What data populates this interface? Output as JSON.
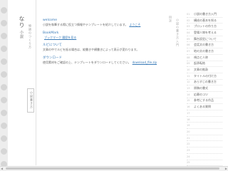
{
  "nav": {
    "logo_line1": "なり",
    "logo_line2": "小説",
    "logo_sub": "物語のつくり方",
    "box_label": "小説書き方"
  },
  "sections": [
    {
      "head": "welcome",
      "body": "小説を執筆する際に役立つ情報やテンプレートを紹介しています。",
      "link": "ようこそ"
    },
    {
      "head": "BookMark",
      "body": "",
      "link": "ブックマーク 履歴を見る"
    },
    {
      "head": "ルビについて",
      "body": "文章の中でルビを振る場合は、縦書きや横書きによって表示が変わります。",
      "link": ""
    },
    {
      "head": "ダウンロード",
      "body": "使用素材をご確認の上、テンプレートをダウンロードしてください。",
      "link": "download_file.zip"
    }
  ],
  "right": {
    "vhead": "目次",
    "vhead2": "小説の書き方入門",
    "items": [
      "小説の書き方入門",
      "構成の基本を知る",
      "プロットの作り方",
      "登場人物を考える",
      "舞台設定について",
      "会話文の書き方",
      "地の文の書き方",
      "視点と人称",
      "起承転結",
      "文章の推敲",
      "タイトルの付け方",
      "あらすじの書き方",
      "原稿の書式",
      "応募のコツ",
      "参考にする作品",
      "よくある質問",
      "",
      "",
      "",
      "",
      "",
      "",
      "",
      "",
      ""
    ]
  },
  "scrollbar": {
    "left_arrow": "◀",
    "right_arrow": "▶"
  }
}
